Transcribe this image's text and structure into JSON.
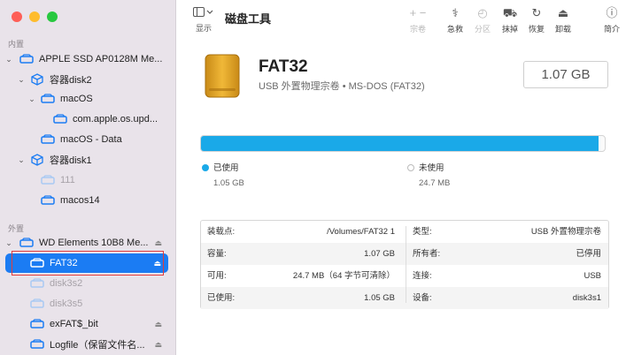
{
  "sidebar": {
    "section_internal": "内置",
    "section_external": "外置",
    "items": [
      {
        "label": "APPLE SSD AP0128M Me..."
      },
      {
        "label": "容器disk2"
      },
      {
        "label": "macOS"
      },
      {
        "label": "com.apple.os.upd..."
      },
      {
        "label": "macOS - Data"
      },
      {
        "label": "容器disk1"
      },
      {
        "label": "111"
      },
      {
        "label": "macos14"
      },
      {
        "label": "WD Elements 10B8 Me..."
      },
      {
        "label": "FAT32"
      },
      {
        "label": "disk3s2"
      },
      {
        "label": "disk3s5"
      },
      {
        "label": "exFAT$_bit"
      },
      {
        "label": "Logfile（保留文件名..."
      }
    ]
  },
  "toolbar": {
    "view_label": "显示",
    "title": "磁盘工具",
    "buttons": [
      {
        "glyph": "+ −",
        "label": "宗卷"
      },
      {
        "glyph": "⚕",
        "label": "急救"
      },
      {
        "glyph": "◴",
        "label": "分区"
      },
      {
        "glyph": "⛟",
        "label": "抹掉"
      },
      {
        "glyph": "↻",
        "label": "恢复"
      },
      {
        "glyph": "⏏",
        "label": "卸载"
      },
      {
        "glyph": "ⓘ",
        "label": "简介"
      }
    ]
  },
  "volume": {
    "name": "FAT32",
    "subtitle": "USB 外置物理宗卷 • MS-DOS (FAT32)",
    "capacity": "1.07 GB"
  },
  "usage": {
    "used_fraction": 0.985,
    "used_label": "已使用",
    "used_value": "1.05 GB",
    "free_label": "未使用",
    "free_value": "24.7 MB"
  },
  "info": {
    "left": [
      {
        "key": "装载点:",
        "value": "/Volumes/FAT32 1"
      },
      {
        "key": "容量:",
        "value": "1.07 GB"
      },
      {
        "key": "可用:",
        "value": "24.7 MB（64 字节可清除）"
      },
      {
        "key": "已使用:",
        "value": "1.05 GB"
      }
    ],
    "right": [
      {
        "key": "类型:",
        "value": "USB 外置物理宗卷"
      },
      {
        "key": "所有者:",
        "value": "已停用"
      },
      {
        "key": "连接:",
        "value": "USB"
      },
      {
        "key": "设备:",
        "value": "disk3s1"
      }
    ]
  },
  "colors": {
    "accent": "#1b7cf3",
    "usage_bar": "#1aa9e8",
    "traffic_close": "#fe5f57",
    "traffic_min": "#febc2e",
    "traffic_max": "#28c840",
    "disk_icon": "#e0a42a"
  }
}
